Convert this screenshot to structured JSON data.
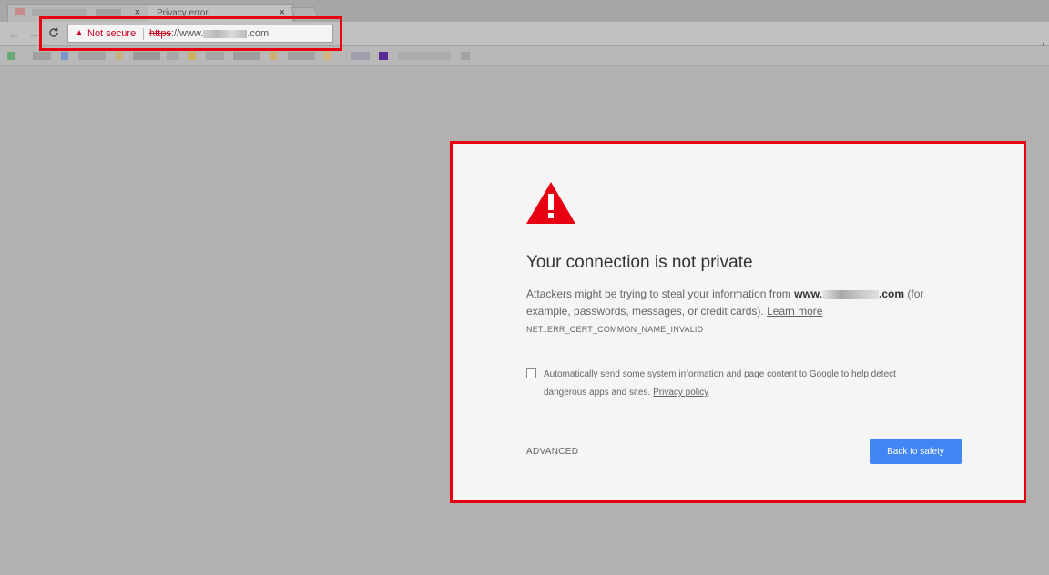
{
  "tabs": [
    {
      "title": "",
      "close": "×"
    },
    {
      "title": "Privacy error",
      "close": "×"
    }
  ],
  "toolbar": {
    "back": "←",
    "forward": "→",
    "reload": "C",
    "omnibox": {
      "security_label": "Not secure",
      "url_scheme": "https",
      "url_prefix": "://www.",
      "url_suffix": ".com"
    }
  },
  "colors": {
    "warning_red": "#d0001e",
    "highlight_red": "#e60012",
    "primary_blue": "#4285f4"
  },
  "interstitial": {
    "icon": "warning-triangle-icon",
    "headline": "Your connection is not private",
    "body_prefix": "Attackers might be trying to steal your information from ",
    "domain_prefix": "www.",
    "domain_suffix": ".com",
    "body_suffix": " (for example, passwords, messages, or credit cards). ",
    "learn_more": "Learn more",
    "error_code": "NET::ERR_CERT_COMMON_NAME_INVALID",
    "report": {
      "prefix": "Automatically send some ",
      "link": "system information and page content",
      "middle": " to Google to help detect dangerous apps and sites. ",
      "privacy_link": "Privacy policy"
    },
    "advanced": "ADVANCED",
    "back_button": "Back to safety"
  }
}
